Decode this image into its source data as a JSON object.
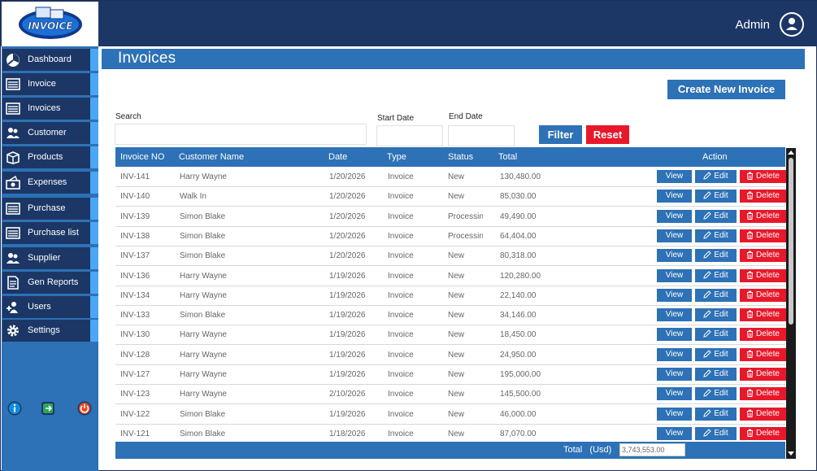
{
  "header": {
    "logo_text": "INVOICE",
    "user_name": "Admin",
    "colors": {
      "header_bg": "#1c3766",
      "accent": "#2d71b6",
      "danger": "#e8182b"
    }
  },
  "sidebar": {
    "items": [
      {
        "label": "Dashboard",
        "icon": "dashboard-icon"
      },
      {
        "label": "Invoice",
        "icon": "invoice-icon"
      },
      {
        "label": "Invoices",
        "icon": "invoices-icon"
      },
      {
        "label": "Customer",
        "icon": "customer-icon"
      },
      {
        "label": "Products",
        "icon": "products-icon"
      },
      {
        "label": "Expenses",
        "icon": "expenses-icon"
      },
      {
        "label": "Purchase",
        "icon": "purchase-icon"
      },
      {
        "label": "Purchase list",
        "icon": "purchase-list-icon"
      },
      {
        "label": "Supplier",
        "icon": "supplier-icon"
      },
      {
        "label": "Gen Reports",
        "icon": "reports-icon"
      },
      {
        "label": "Users",
        "icon": "add-user-icon"
      },
      {
        "label": "Settings",
        "icon": "gear-icon"
      }
    ],
    "bottom_icons": [
      "info-icon",
      "logout-icon",
      "power-icon"
    ]
  },
  "main": {
    "title": "Invoices",
    "create_label": "Create New Invoice",
    "search_label": "Search",
    "search_value": "",
    "start_label": "Start Date",
    "start_value": "",
    "end_label": "End Date",
    "end_value": "",
    "filter_label": "Filter",
    "reset_label": "Reset"
  },
  "table": {
    "headers": [
      "Invoice NO",
      "Customer Name",
      "Date",
      "Type",
      "Status",
      "Total",
      "Action"
    ],
    "view_label": "View",
    "edit_label": "Edit",
    "delete_label": "Delete",
    "rows": [
      {
        "no": "INV-141",
        "customer": "Harry Wayne",
        "date": "1/20/2026",
        "type": "Invoice",
        "status": "New",
        "total": "130,480.00"
      },
      {
        "no": "INV-140",
        "customer": "Walk In",
        "date": "1/20/2026",
        "type": "Invoice",
        "status": "New",
        "total": "85,030.00"
      },
      {
        "no": "INV-139",
        "customer": "Simon Blake",
        "date": "1/20/2026",
        "type": "Invoice",
        "status": "Processing",
        "total": "49,490.00"
      },
      {
        "no": "INV-138",
        "customer": "Simon Blake",
        "date": "1/20/2026",
        "type": "Invoice",
        "status": "Processing",
        "total": "64,404.00"
      },
      {
        "no": "INV-137",
        "customer": "Simon Blake",
        "date": "1/20/2026",
        "type": "Invoice",
        "status": "New",
        "total": "80,318.00"
      },
      {
        "no": "INV-136",
        "customer": "Harry Wayne",
        "date": "1/19/2026",
        "type": "Invoice",
        "status": "New",
        "total": "120,280.00"
      },
      {
        "no": "INV-134",
        "customer": "Harry Wayne",
        "date": "1/19/2026",
        "type": "Invoice",
        "status": "New",
        "total": "22,140.00"
      },
      {
        "no": "INV-133",
        "customer": "Simon Blake",
        "date": "1/19/2026",
        "type": "Invoice",
        "status": "New",
        "total": "34,146.00"
      },
      {
        "no": "INV-130",
        "customer": "Harry Wayne",
        "date": "1/19/2026",
        "type": "Invoice",
        "status": "New",
        "total": "18,450.00"
      },
      {
        "no": "INV-128",
        "customer": "Harry Wayne",
        "date": "1/19/2026",
        "type": "Invoice",
        "status": "New",
        "total": "24,950.00"
      },
      {
        "no": "INV-127",
        "customer": "Harry Wayne",
        "date": "1/19/2026",
        "type": "Invoice",
        "status": "New",
        "total": "195,000.00"
      },
      {
        "no": "INV-123",
        "customer": "Harry Wayne",
        "date": "2/10/2026",
        "type": "Invoice",
        "status": "New",
        "total": "145,500.00"
      },
      {
        "no": "INV-122",
        "customer": "Simon Blake",
        "date": "1/19/2026",
        "type": "Invoice",
        "status": "New",
        "total": "46,000.00"
      },
      {
        "no": "INV-121",
        "customer": "Simon Blake",
        "date": "1/18/2026",
        "type": "Invoice",
        "status": "New",
        "total": "87,070.00"
      }
    ],
    "total_label": "Total",
    "currency_label": "(Usd)",
    "total_value": "3,743,553.00"
  }
}
